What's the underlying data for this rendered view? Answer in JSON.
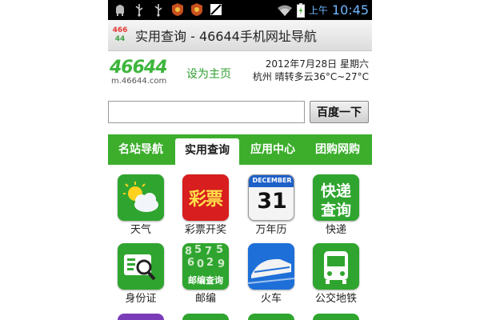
{
  "status_bar": {
    "ampm": "上午",
    "time": "10:45",
    "icons": [
      "android-icon",
      "usb-icon",
      "usb-icon",
      "badge-icon",
      "badge-icon",
      "image-icon"
    ],
    "right_icons": [
      "wifi-icon",
      "battery-icon"
    ]
  },
  "title_bar": {
    "logo_line1": "466",
    "logo_line2": "44",
    "title": "实用查询 - 46644手机网址导航"
  },
  "header": {
    "brand": "46644",
    "brand_url": "m.46644.com",
    "set_home": "设为主页",
    "date": "2012年7月28日 星期六",
    "weather": "杭州 晴转多云36°C~27°C"
  },
  "search": {
    "value": "",
    "button_label": "百度一下"
  },
  "tabs": [
    {
      "label": "名站导航",
      "active": false
    },
    {
      "label": "实用查询",
      "active": true
    },
    {
      "label": "应用中心",
      "active": false
    },
    {
      "label": "团购网购",
      "active": false
    }
  ],
  "grid": [
    {
      "label": "天气",
      "icon": "weather-icon",
      "color": "#2fa52f"
    },
    {
      "label": "彩票开奖",
      "icon": "lottery-icon",
      "color": "#d81e1e",
      "text": "彩票"
    },
    {
      "label": "万年历",
      "icon": "calendar-icon",
      "color": "#1e6fd8",
      "month": "DECEMBER",
      "day": "31"
    },
    {
      "label": "快递",
      "icon": "express-icon",
      "color": "#2fa52f",
      "text1": "快递",
      "text2": "查询"
    },
    {
      "label": "身份证",
      "icon": "id-card-icon",
      "color": "#2fa52f"
    },
    {
      "label": "邮编",
      "icon": "postcode-icon",
      "color": "#2fa52f",
      "text": "邮编查询"
    },
    {
      "label": "火车",
      "icon": "train-icon",
      "color": "#1e6fd8"
    },
    {
      "label": "公交地铁",
      "icon": "bus-icon",
      "color": "#2fa52f"
    }
  ],
  "partial_row_colors": [
    "#7a3cb8",
    "#2fa52f",
    "#2fa52f",
    "#2fa52f"
  ]
}
